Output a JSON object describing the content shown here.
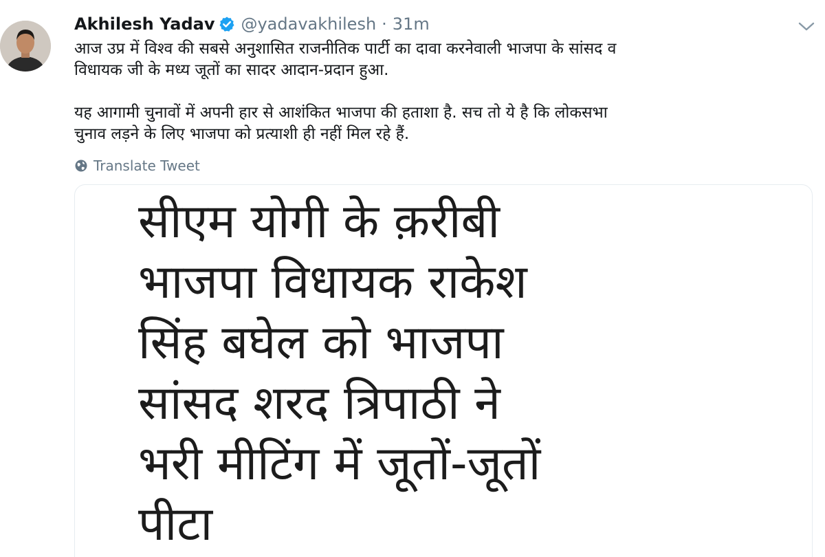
{
  "author": {
    "name": "Akhilesh Yadav",
    "handle": "@yadavakhilesh",
    "separator": "·",
    "time": "31m"
  },
  "tweet": {
    "paragraphs": [
      {
        "lines": [
          "आज उप्र में विश्व की सबसे अनुशासित राजनीतिक पार्टी का दावा करनेवाली भाजपा के सांसद व",
          "विधायक जी के मध्य जूतों का सादर आदान-प्रदान हुआ."
        ]
      },
      {
        "lines": [
          "यह आगामी चुनावों में अपनी हार से आशंकित भाजपा की हताशा है. सच तो ये है कि लोकसभा",
          "चुनाव लड़ने के लिए भाजपा को प्रत्याशी ही नहीं मिल रहे हैं."
        ]
      }
    ],
    "translate_label": "Translate Tweet"
  },
  "media": {
    "headline_lines": [
      "सीएम योगी के क़रीबी",
      "भाजपा विधायक राकेश",
      "सिंह बघेल को भाजपा",
      "सांसद शरद त्रिपाठी ने",
      "भरी मीटिंग में जूतों-जूतों",
      "पीटा"
    ]
  },
  "colors": {
    "verified": "#1da1f2",
    "muted": "#657786",
    "text": "#14171a"
  },
  "icons": [
    "avatar",
    "verified-icon",
    "chevron-down-icon",
    "globe-icon"
  ]
}
